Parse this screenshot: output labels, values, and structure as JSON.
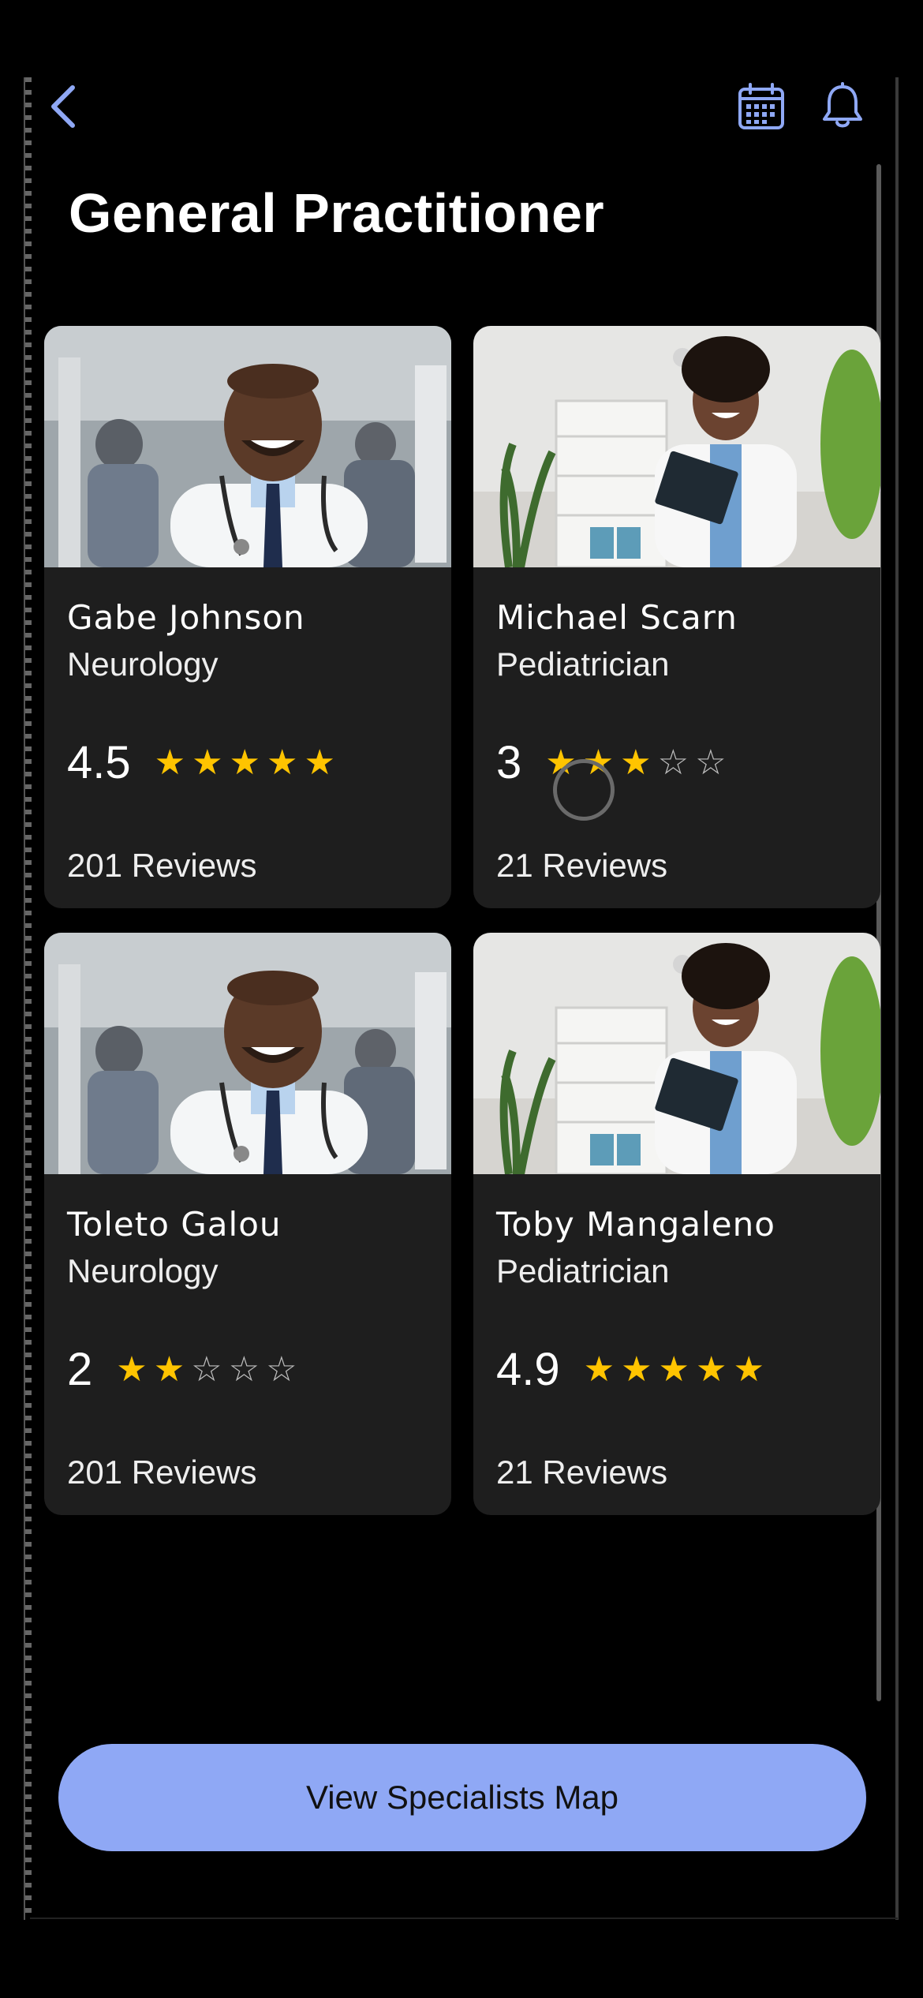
{
  "header": {
    "title": "General Practitioner",
    "back_icon": "chevron-left-icon",
    "calendar_icon": "calendar-icon",
    "bell_icon": "bell-icon",
    "accent_color": "#8fa8f5"
  },
  "doctors": [
    {
      "name": "Gabe Johnson",
      "specialty": "Neurology",
      "rating": "4.5",
      "stars_filled": 5,
      "reviews": "201 Reviews",
      "photo": "male-doctor-photo"
    },
    {
      "name": "Michael Scarn",
      "specialty": "Pediatrician",
      "rating": "3",
      "stars_filled": 3,
      "reviews": "21 Reviews",
      "photo": "female-doctor-photo"
    },
    {
      "name": "Toleto Galou",
      "specialty": "Neurology",
      "rating": "2",
      "stars_filled": 2,
      "reviews": "201 Reviews",
      "photo": "male-doctor-photo"
    },
    {
      "name": "Toby Mangaleno",
      "specialty": "Pediatrician",
      "rating": "4.9",
      "stars_filled": 5,
      "reviews": "21 Reviews",
      "photo": "female-doctor-photo"
    }
  ],
  "star_color": "#ffc400",
  "map_button": {
    "label": "View Specialists Map",
    "color": "#8fa8f5"
  }
}
